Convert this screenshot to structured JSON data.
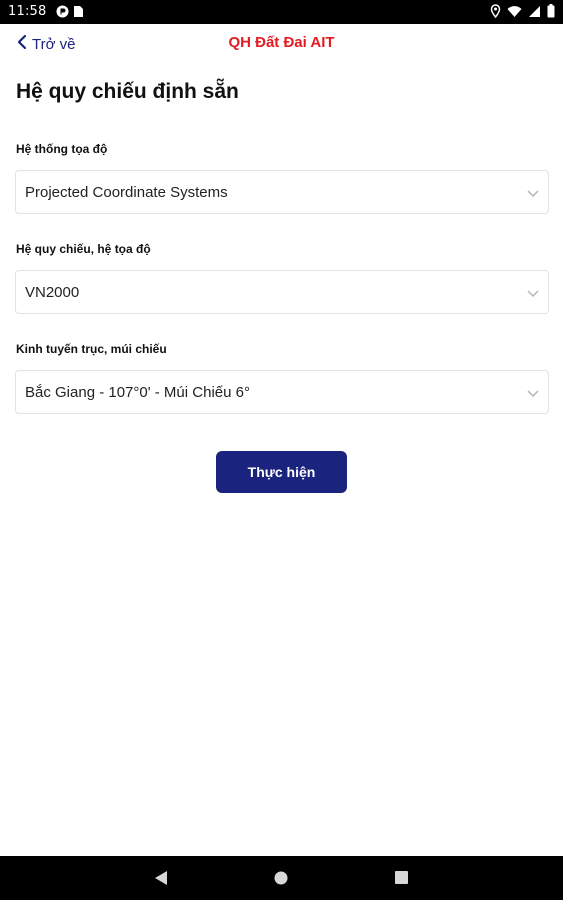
{
  "status_bar": {
    "time": "11:58",
    "left_icons": [
      "app-notification-icon",
      "sim-card-icon"
    ],
    "right_icons": [
      "location-icon",
      "wifi-icon",
      "signal-icon",
      "battery-icon"
    ]
  },
  "header": {
    "back_label": "Trở về",
    "app_title": "QH Đất Đai AIT"
  },
  "page": {
    "title": "Hệ quy chiếu định sẵn"
  },
  "fields": {
    "coordinate_system": {
      "label": "Hệ thống tọa độ",
      "value": "Projected Coordinate Systems"
    },
    "reference_system": {
      "label": "Hệ quy chiếu, hệ tọa độ",
      "value": "VN2000"
    },
    "meridian_zone": {
      "label": "Kinh tuyến trục, múi chiếu",
      "value": "Bắc Giang - 107°0' - Múi Chiếu 6°"
    }
  },
  "actions": {
    "execute_label": "Thực hiện"
  },
  "nav_bar": {
    "buttons": [
      "back-icon",
      "home-icon",
      "recents-icon"
    ]
  },
  "colors": {
    "primary": "#1a237e",
    "title_red": "#e31b23",
    "border": "#e2e2e2"
  }
}
